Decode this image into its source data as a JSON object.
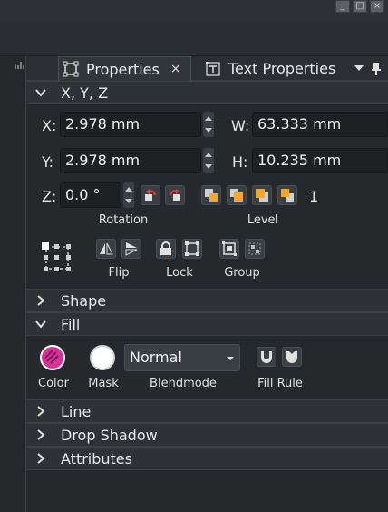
{
  "window": {
    "minimize_label": "_",
    "maximize_label": "□",
    "close_label": "×"
  },
  "tabs": [
    {
      "label": "Properties",
      "close": "×"
    },
    {
      "label": "Text Properties"
    }
  ],
  "sections": {
    "xyz": {
      "title": "X, Y, Z"
    },
    "shape": {
      "title": "Shape"
    },
    "fill": {
      "title": "Fill"
    },
    "line": {
      "title": "Line"
    },
    "drop_shadow": {
      "title": "Drop Shadow"
    },
    "attributes": {
      "title": "Attributes"
    }
  },
  "xyz": {
    "x_label": "X:",
    "x_value": "2.978 mm",
    "w_label": "W:",
    "w_value": "63.333 mm",
    "y_label": "Y:",
    "y_value": "2.978 mm",
    "h_label": "H:",
    "h_value": "10.235 mm",
    "z_label": "Z:",
    "z_value": "0.0 °",
    "level_value": "1",
    "rotation_caption": "Rotation",
    "level_caption": "Level",
    "flip_caption": "Flip",
    "lock_caption": "Lock",
    "group_caption": "Group"
  },
  "fill": {
    "color_caption": "Color",
    "mask_caption": "Mask",
    "blendmode_value": "Normal",
    "blendmode_caption": "Blendmode",
    "fillrule_caption": "Fill Rule",
    "color_swatch": "#d6339a",
    "mask_swatch": "#ffffff"
  },
  "colors": {
    "panel_bg": "#25292c",
    "header_bg": "#2e3236",
    "field_bg": "#1e2124",
    "accent_orange": "#f0a830"
  }
}
